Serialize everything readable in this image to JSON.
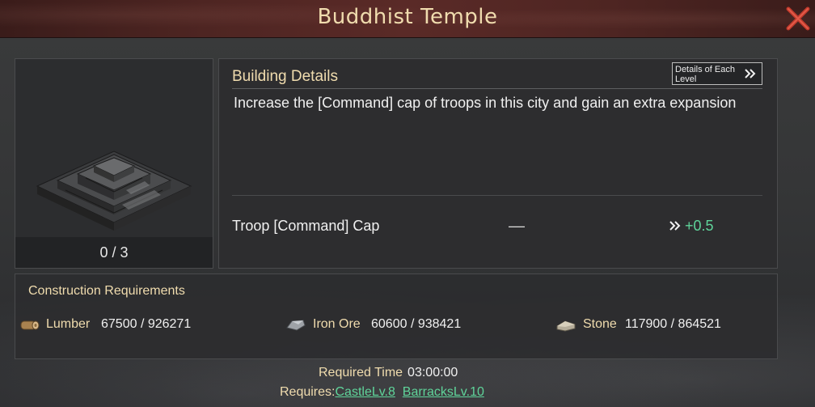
{
  "header": {
    "title": "Buddhist Temple",
    "close_icon": "close-x-icon",
    "close_color": "#c0392b"
  },
  "building": {
    "image": "temple-building-illustration",
    "level": "0 / 3"
  },
  "details": {
    "title": "Building Details",
    "each_level_button": "Details of Each Level",
    "each_level_icon": "double-chevron-right-icon",
    "description": "Increase the [Command] cap of troops in this city and gain an extra expansion",
    "stat": {
      "label": "Troop [Command] Cap",
      "current": "––",
      "arrow_icon": "double-chevron-right-icon",
      "next": "+0.5",
      "next_color": "#5fd49a"
    }
  },
  "requirements": {
    "title": "Construction Requirements",
    "resources": [
      {
        "icon": "lumber-icon",
        "name": "Lumber",
        "value": "67500 / 926271"
      },
      {
        "icon": "iron-ore-icon",
        "name": "Iron Ore",
        "value": "60600 / 938421"
      },
      {
        "icon": "stone-icon",
        "name": "Stone",
        "value": "117900 / 864521"
      }
    ]
  },
  "footer": {
    "time_label": "Required Time",
    "time_value": "03:00:00",
    "requires_label": "Requires:",
    "requires": [
      "CastleLv.8",
      "BarracksLv.10"
    ]
  },
  "colors": {
    "accent_gold": "#f0dcae",
    "positive_green": "#5fd49a",
    "header_red": "#5a2a27"
  }
}
